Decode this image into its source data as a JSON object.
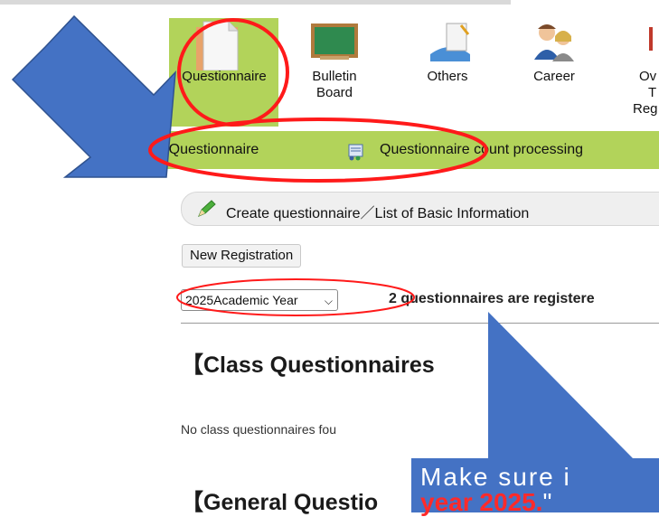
{
  "menu": {
    "items": [
      {
        "label": "Questionnaire"
      },
      {
        "label_l1": "Bulletin",
        "label_l2": "Board"
      },
      {
        "label": "Others"
      },
      {
        "label": "Career"
      },
      {
        "label_l1": "Ov",
        "label_l2": "T",
        "label_l3": "Reg"
      }
    ]
  },
  "submenu": {
    "item1": "er Questionnaire",
    "item2": "Questionnaire count processing"
  },
  "content": {
    "section_header": "Create questionnaire／List of Basic Information",
    "new_registration_label": "New Registration",
    "year_select_value": "2025Academic Year",
    "count_text": "2 questionnaires are registere",
    "class_heading": "【Class Questionnaires",
    "no_class_text": "No class questionnaires fou",
    "general_heading": "【General Questio"
  },
  "callout": {
    "line1": "Make sure i",
    "line2_red": "year 2025.",
    "line2_quote": "\""
  },
  "colors": {
    "menu_green": "#b2d35a",
    "annotation_red": "#ff1a1a",
    "annotation_blue": "#4472c4"
  }
}
